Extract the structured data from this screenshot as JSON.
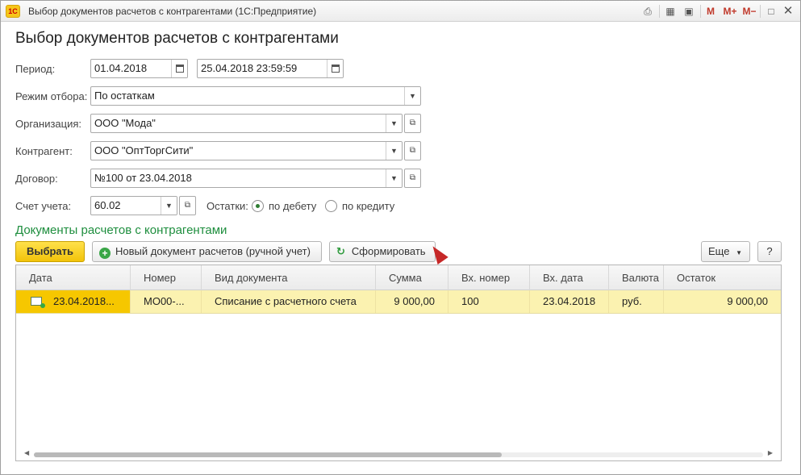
{
  "window": {
    "title": "Выбор документов расчетов с контрагентами  (1С:Предприятие)",
    "logo_text": "1С",
    "toolbar": {
      "m": "M",
      "m_plus": "M+",
      "m_minus": "M−"
    }
  },
  "form": {
    "title": "Выбор документов расчетов с контрагентами",
    "period": {
      "label": "Период:",
      "from": "01.04.2018",
      "to": "25.04.2018 23:59:59"
    },
    "mode": {
      "label": "Режим отбора:",
      "value": "По остаткам"
    },
    "organization": {
      "label": "Организация:",
      "value": "ООО \"Мода\""
    },
    "counterparty": {
      "label": "Контрагент:",
      "value": "ООО \"ОптТоргСити\""
    },
    "contract": {
      "label": "Договор:",
      "value": "№100 от 23.04.2018"
    },
    "account": {
      "label": "Счет учета:",
      "value": "60.02"
    },
    "balances": {
      "label": "Остатки:",
      "debit": "по дебету",
      "credit": "по кредиту",
      "selected": "debit"
    }
  },
  "section": {
    "title": "Документы расчетов с контрагентами"
  },
  "buttons": {
    "select": "Выбрать",
    "new_doc": "Новый документ расчетов (ручной учет)",
    "generate": "Сформировать",
    "more": "Еще",
    "help": "?"
  },
  "table": {
    "columns": [
      "Дата",
      "Номер",
      "Вид документа",
      "Сумма",
      "Вх. номер",
      "Вх. дата",
      "Валюта",
      "Остаток"
    ],
    "rows": [
      [
        "23.04.2018...",
        "МО00-...",
        "Списание с расчетного счета",
        "9 000,00",
        "100",
        "23.04.2018",
        "руб.",
        "9 000,00"
      ]
    ]
  },
  "colors": {
    "accent": "#f2c30a",
    "section": "#1e8e3e",
    "row_highlight": "#fbf2b0"
  }
}
